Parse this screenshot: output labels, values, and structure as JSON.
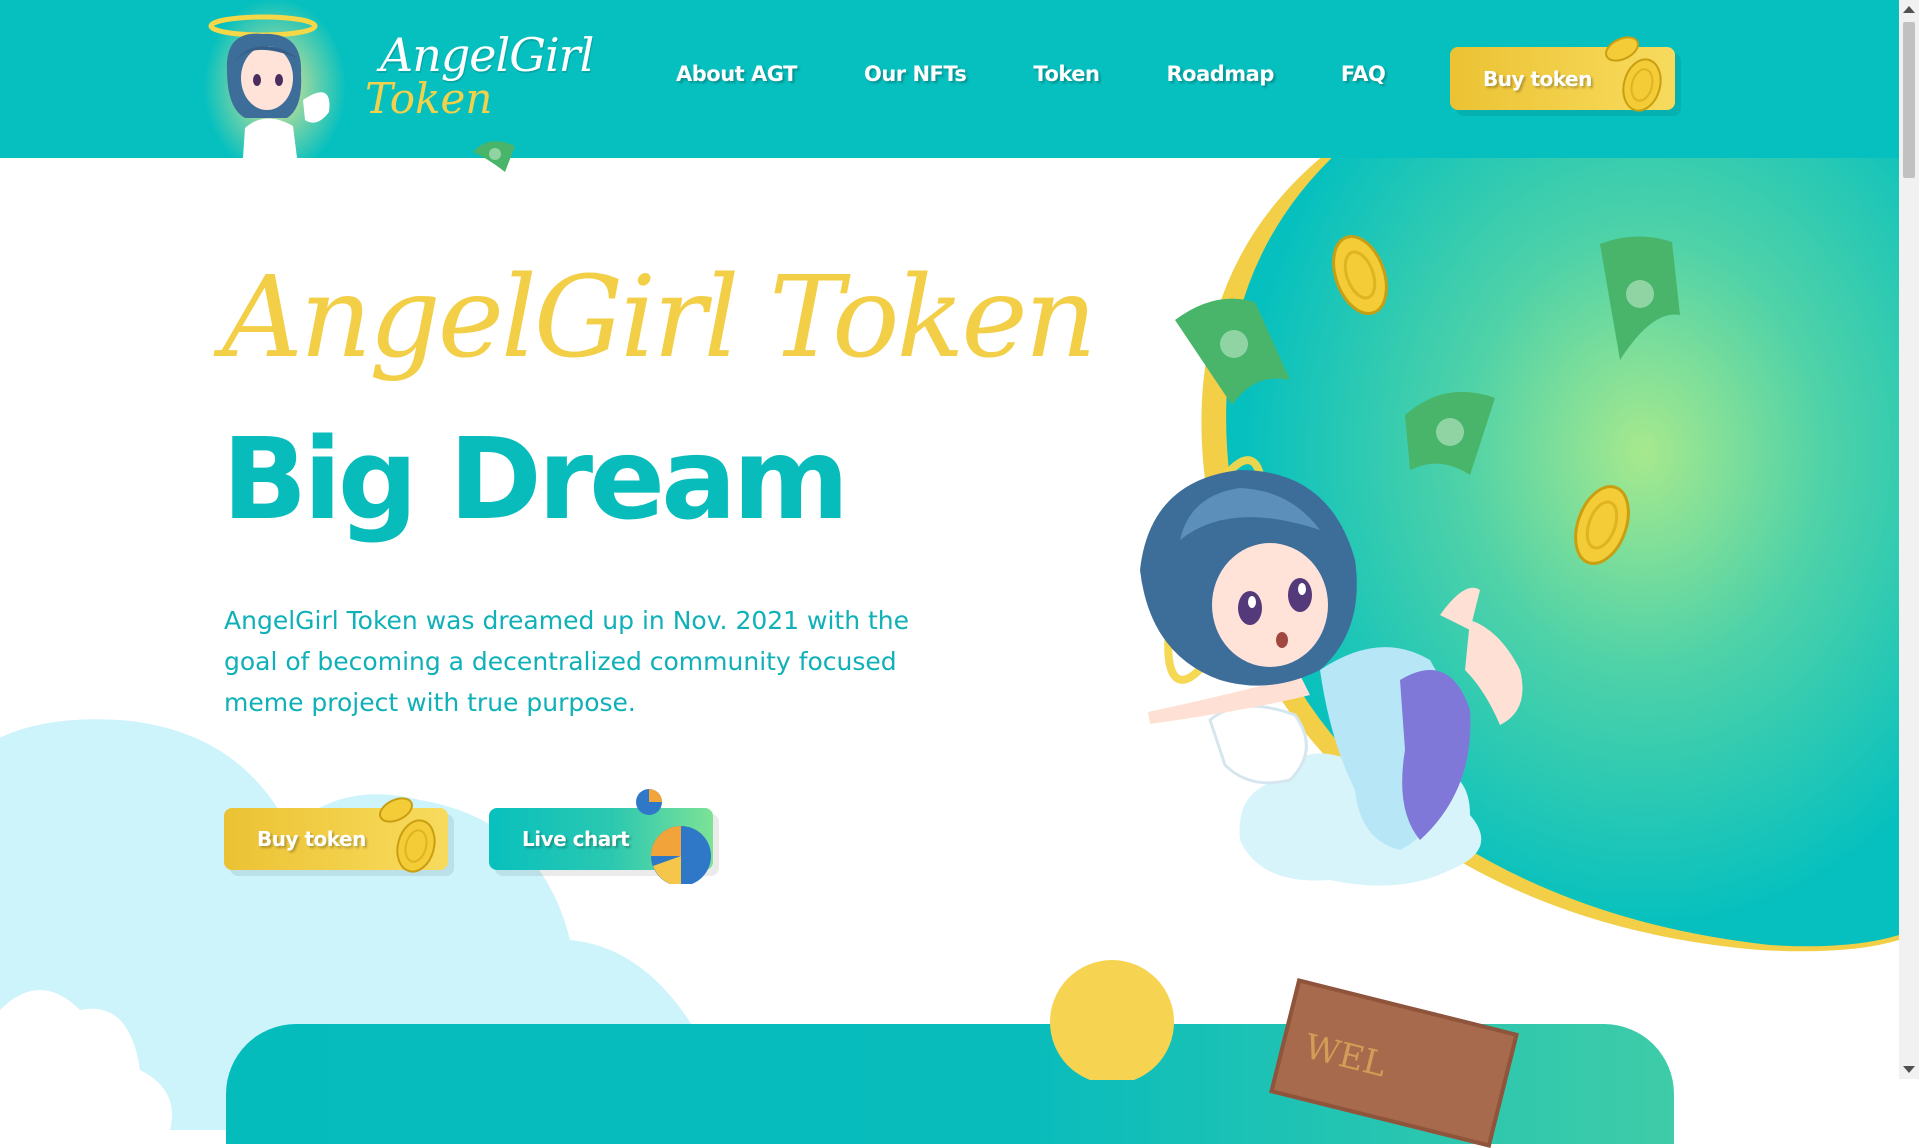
{
  "logo": {
    "line1": "AngelGirl",
    "line2": "Token"
  },
  "nav": {
    "items": [
      {
        "label": "About AGT"
      },
      {
        "label": "Our NFTs"
      },
      {
        "label": "Token"
      },
      {
        "label": "Roadmap"
      },
      {
        "label": "FAQ"
      }
    ]
  },
  "header": {
    "buy_label": "Buy token"
  },
  "hero": {
    "title_script": "AngelGirl Token",
    "title_bold": "Big Dream",
    "description": "AngelGirl Token was dreamed up in Nov. 2021 with the goal of becoming a decentralized community focused meme project with true purpose.",
    "buy_label": "Buy token",
    "chart_label": "Live chart"
  },
  "bottom_sign": {
    "text": "WEL"
  },
  "colors": {
    "teal": "#05c0bf",
    "gold": "#f2cf47",
    "text_teal": "#0fb0b8",
    "green_glow": "#a7e98d"
  },
  "icons": [
    "coin-icon",
    "pie-chart-icon",
    "banknote-icon",
    "halo-icon"
  ]
}
